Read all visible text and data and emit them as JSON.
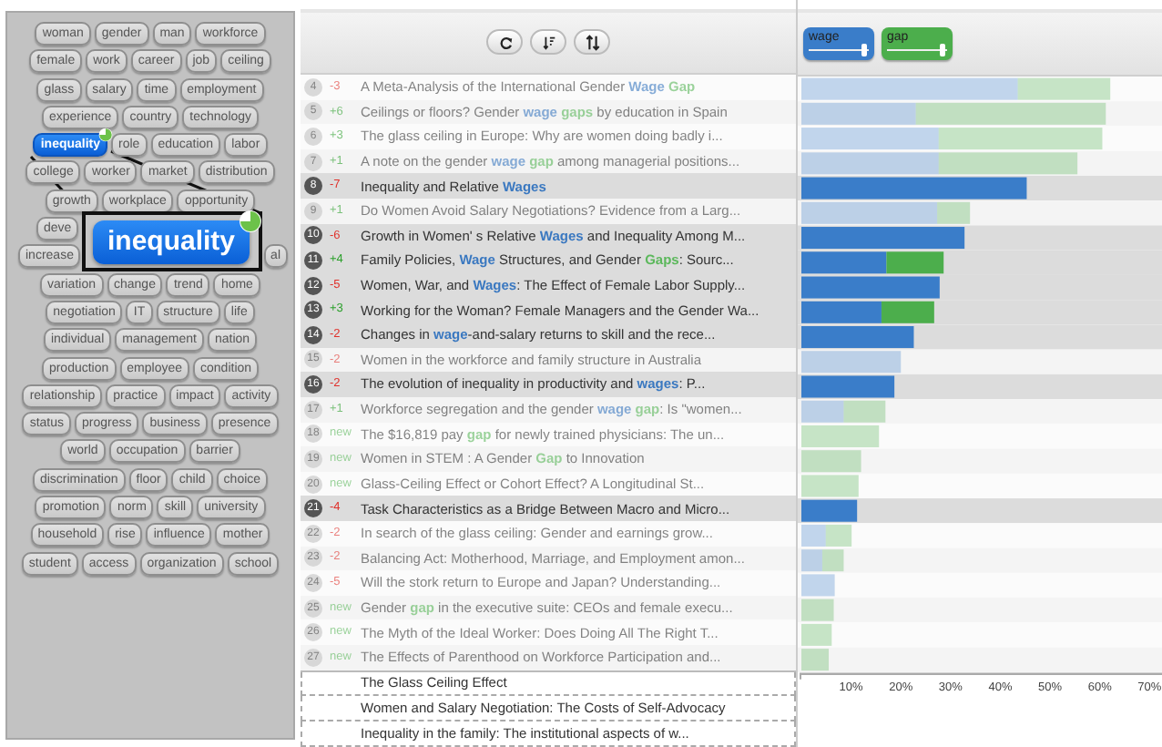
{
  "tag_cloud": {
    "rows": [
      [
        {
          "text": "woman",
          "selected": false
        },
        {
          "text": "gender",
          "selected": false
        },
        {
          "text": "man",
          "selected": false
        },
        {
          "text": "workforce",
          "selected": false
        }
      ],
      [
        {
          "text": "female",
          "selected": false
        },
        {
          "text": "work",
          "selected": false
        },
        {
          "text": "career",
          "selected": false
        },
        {
          "text": "job",
          "selected": false
        },
        {
          "text": "ceiling",
          "selected": false
        }
      ],
      [
        {
          "text": "glass",
          "selected": false
        },
        {
          "text": "salary",
          "selected": false
        },
        {
          "text": "time",
          "selected": false
        },
        {
          "text": "employment",
          "selected": false
        }
      ],
      [
        {
          "text": "experience",
          "selected": false
        },
        {
          "text": "country",
          "selected": false
        },
        {
          "text": "technology",
          "selected": false
        }
      ],
      [
        {
          "text": "inequality",
          "selected": true
        },
        {
          "text": "role",
          "selected": false
        },
        {
          "text": "education",
          "selected": false
        },
        {
          "text": "labor",
          "selected": false
        }
      ],
      [
        {
          "text": "college",
          "selected": false
        },
        {
          "text": "worker",
          "selected": false
        },
        {
          "text": "market",
          "selected": false
        },
        {
          "text": "distribution",
          "selected": false
        }
      ],
      [
        {
          "text": "growth",
          "selected": false
        },
        {
          "text": "workplace",
          "selected": false
        },
        {
          "text": "opportunity",
          "selected": false
        }
      ],
      [
        {
          "text": "deve",
          "selected": false
        }
      ],
      [
        {
          "text": "increase",
          "selected": false
        },
        {
          "text": "al",
          "selected": false
        }
      ],
      [
        {
          "text": "variation",
          "selected": false
        },
        {
          "text": "change",
          "selected": false
        },
        {
          "text": "trend",
          "selected": false
        },
        {
          "text": "home",
          "selected": false
        }
      ],
      [
        {
          "text": "negotiation",
          "selected": false
        },
        {
          "text": "IT",
          "selected": false
        },
        {
          "text": "structure",
          "selected": false
        },
        {
          "text": "life",
          "selected": false
        }
      ],
      [
        {
          "text": "individual",
          "selected": false
        },
        {
          "text": "management",
          "selected": false
        },
        {
          "text": "nation",
          "selected": false
        }
      ],
      [
        {
          "text": "production",
          "selected": false
        },
        {
          "text": "employee",
          "selected": false
        },
        {
          "text": "condition",
          "selected": false
        }
      ],
      [
        {
          "text": "relationship",
          "selected": false
        },
        {
          "text": "practice",
          "selected": false
        },
        {
          "text": "impact",
          "selected": false
        },
        {
          "text": "activity",
          "selected": false
        }
      ],
      [
        {
          "text": "status",
          "selected": false
        },
        {
          "text": "progress",
          "selected": false
        },
        {
          "text": "business",
          "selected": false
        },
        {
          "text": "presence",
          "selected": false
        }
      ],
      [
        {
          "text": "world",
          "selected": false
        },
        {
          "text": "occupation",
          "selected": false
        },
        {
          "text": "barrier",
          "selected": false
        }
      ],
      [
        {
          "text": "discrimination",
          "selected": false
        },
        {
          "text": "floor",
          "selected": false
        },
        {
          "text": "child",
          "selected": false
        },
        {
          "text": "choice",
          "selected": false
        }
      ],
      [
        {
          "text": "promotion",
          "selected": false
        },
        {
          "text": "norm",
          "selected": false
        },
        {
          "text": "skill",
          "selected": false
        },
        {
          "text": "university",
          "selected": false
        }
      ],
      [
        {
          "text": "household",
          "selected": false
        },
        {
          "text": "rise",
          "selected": false
        },
        {
          "text": "influence",
          "selected": false
        },
        {
          "text": "mother",
          "selected": false
        }
      ],
      [
        {
          "text": "student",
          "selected": false
        },
        {
          "text": "access",
          "selected": false
        },
        {
          "text": "organization",
          "selected": false
        },
        {
          "text": "school",
          "selected": false
        }
      ]
    ]
  },
  "magnifier": {
    "text": "inequality"
  },
  "weights": [
    {
      "level": 0.93
    },
    {
      "level": 0.93
    }
  ],
  "rows": [
    {
      "rank": "4",
      "change": "-3",
      "kind": "down",
      "selected": false,
      "title": [
        {
          "text": "A Meta-Analysis of the International Gender "
        },
        {
          "text": "Wage ",
          "kind": "wage"
        },
        {
          "text": "Gap",
          "kind": "gap"
        }
      ]
    },
    {
      "rank": "5",
      "change": "+6",
      "kind": "up",
      "selected": false,
      "title": [
        {
          "text": "Ceilings or floors? Gender "
        },
        {
          "text": "wage ",
          "kind": "wage"
        },
        {
          "text": "gaps",
          "kind": "gap"
        },
        {
          "text": " by education in Spain"
        }
      ]
    },
    {
      "rank": "6",
      "change": "+3",
      "kind": "up",
      "selected": false,
      "title": [
        {
          "text": "The glass ceiling in Europe: Why are women doing badly i..."
        }
      ]
    },
    {
      "rank": "7",
      "change": "+1",
      "kind": "up",
      "selected": false,
      "title": [
        {
          "text": "A note on the gender "
        },
        {
          "text": "wage ",
          "kind": "wage"
        },
        {
          "text": "gap",
          "kind": "gap"
        },
        {
          "text": " among managerial positions..."
        }
      ]
    },
    {
      "rank": "8",
      "change": "-7",
      "kind": "down",
      "selected": true,
      "title": [
        {
          "text": "Inequality and Relative "
        },
        {
          "text": "Wages",
          "kind": "wage"
        }
      ]
    },
    {
      "rank": "9",
      "change": "+1",
      "kind": "up",
      "selected": false,
      "title": [
        {
          "text": "Do Women Avoid Salary Negotiations? Evidence from a Larg..."
        }
      ]
    },
    {
      "rank": "10",
      "change": "-6",
      "kind": "down",
      "selected": true,
      "title": [
        {
          "text": "Growth in Women' s Relative "
        },
        {
          "text": "Wages",
          "kind": "wage"
        },
        {
          "text": " and Inequality Among M..."
        }
      ]
    },
    {
      "rank": "11",
      "change": "+4",
      "kind": "up",
      "selected": true,
      "title": [
        {
          "text": "Family Policies, "
        },
        {
          "text": "Wage",
          "kind": "wage"
        },
        {
          "text": " Structures, and Gender "
        },
        {
          "text": "Gaps",
          "kind": "gap"
        },
        {
          "text": ": Sourc..."
        }
      ]
    },
    {
      "rank": "12",
      "change": "-5",
      "kind": "down",
      "selected": true,
      "title": [
        {
          "text": "Women, War, and "
        },
        {
          "text": "Wages",
          "kind": "wage"
        },
        {
          "text": ": The Effect of Female Labor Supply..."
        }
      ]
    },
    {
      "rank": "13",
      "change": "+3",
      "kind": "up",
      "selected": true,
      "title": [
        {
          "text": "Working for the Woman? Female Managers and the Gender Wa..."
        }
      ]
    },
    {
      "rank": "14",
      "change": "-2",
      "kind": "down",
      "selected": true,
      "title": [
        {
          "text": "Changes in "
        },
        {
          "text": "wage",
          "kind": "wage"
        },
        {
          "text": "-and-salary returns to skill and the rece..."
        }
      ]
    },
    {
      "rank": "15",
      "change": "-2",
      "kind": "down",
      "selected": false,
      "title": [
        {
          "text": "Women in the workforce and family structure in Australia"
        }
      ]
    },
    {
      "rank": "16",
      "change": "-2",
      "kind": "down",
      "selected": true,
      "title": [
        {
          "text": "The evolution of inequality in productivity and "
        },
        {
          "text": "wages",
          "kind": "wage"
        },
        {
          "text": ": P..."
        }
      ]
    },
    {
      "rank": "17",
      "change": "+1",
      "kind": "up",
      "selected": false,
      "title": [
        {
          "text": "Workforce segregation and the gender "
        },
        {
          "text": "wage ",
          "kind": "wage"
        },
        {
          "text": "gap",
          "kind": "gap"
        },
        {
          "text": ": Is \"women..."
        }
      ]
    },
    {
      "rank": "18",
      "change": "new",
      "kind": "new",
      "selected": false,
      "title": [
        {
          "text": "The $16,819 pay "
        },
        {
          "text": "gap",
          "kind": "gap"
        },
        {
          "text": " for newly trained physicians: The un..."
        }
      ]
    },
    {
      "rank": "19",
      "change": "new",
      "kind": "new",
      "selected": false,
      "title": [
        {
          "text": "Women in STEM : A Gender "
        },
        {
          "text": "Gap",
          "kind": "gap"
        },
        {
          "text": " to Innovation"
        }
      ]
    },
    {
      "rank": "20",
      "change": "new",
      "kind": "new",
      "selected": false,
      "title": [
        {
          "text": "Glass-Ceiling Effect or Cohort Effect? A Longitudinal St..."
        }
      ]
    },
    {
      "rank": "21",
      "change": "-4",
      "kind": "down",
      "selected": true,
      "title": [
        {
          "text": "Task Characteristics as a Bridge Between Macro and Micro..."
        }
      ]
    },
    {
      "rank": "22",
      "change": "-2",
      "kind": "down",
      "selected": false,
      "title": [
        {
          "text": "In search of the glass ceiling: Gender and earnings grow..."
        }
      ]
    },
    {
      "rank": "23",
      "change": "-2",
      "kind": "down",
      "selected": false,
      "title": [
        {
          "text": "Balancing Act: Motherhood, Marriage, and Employment amon..."
        }
      ]
    },
    {
      "rank": "24",
      "change": "-5",
      "kind": "down",
      "selected": false,
      "title": [
        {
          "text": "Will the stork return to Europe and Japan? Understanding..."
        }
      ]
    },
    {
      "rank": "25",
      "change": "new",
      "kind": "new",
      "selected": false,
      "title": [
        {
          "text": "Gender "
        },
        {
          "text": "gap",
          "kind": "gap"
        },
        {
          "text": " in the executive suite: CEOs and female execu..."
        }
      ]
    },
    {
      "rank": "26",
      "change": "new",
      "kind": "new",
      "selected": false,
      "title": [
        {
          "text": "The Myth of the Ideal Worker: Does Doing All The Right T..."
        }
      ]
    },
    {
      "rank": "27",
      "change": "new",
      "kind": "new",
      "selected": false,
      "title": [
        {
          "text": "The Effects of Parenthood on Workforce Participation and..."
        }
      ]
    }
  ],
  "unranked": [
    {
      "title": "The Glass Ceiling Effect"
    },
    {
      "title": "Women and Salary Negotiation: The Costs of Self-Advocacy"
    },
    {
      "title": "Inequality in the family: The institutional aspects of w..."
    }
  ],
  "chart": {
    "chart_data": {
      "type": "bar",
      "orientation": "horizontal",
      "stacked": true,
      "series": [
        {
          "name": "wage",
          "color": "#3a7dc9",
          "values": [
            43.5,
            23.0,
            27.6,
            27.6,
            45.3,
            27.3,
            32.8,
            17.1,
            27.8,
            16.1,
            22.6,
            20.0,
            18.7,
            8.5,
            null,
            null,
            null,
            11.2,
            4.9,
            4.2,
            6.7,
            null,
            null,
            null
          ]
        },
        {
          "name": "gap",
          "color": "#4cae4c",
          "values": [
            18.6,
            38.2,
            32.9,
            27.9,
            null,
            6.6,
            null,
            11.5,
            null,
            10.6,
            null,
            null,
            null,
            8.4,
            15.6,
            12.0,
            11.5,
            null,
            5.2,
            4.3,
            null,
            6.5,
            6.1,
            5.5
          ]
        }
      ],
      "xlim": [
        0,
        72.5
      ],
      "xticks": [
        {
          "value": 10,
          "label": "10%"
        },
        {
          "value": 20,
          "label": "20%"
        },
        {
          "value": 30,
          "label": "30%"
        },
        {
          "value": 40,
          "label": "40%"
        },
        {
          "value": 50,
          "label": "50%"
        },
        {
          "value": 60,
          "label": "60%"
        },
        {
          "value": 70,
          "label": "70%"
        }
      ]
    }
  }
}
